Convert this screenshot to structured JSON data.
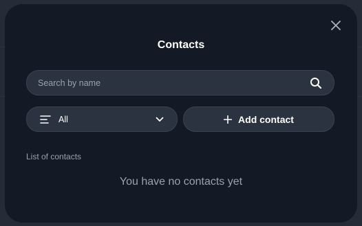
{
  "modal": {
    "title": "Contacts",
    "close_icon": "close-icon"
  },
  "search": {
    "placeholder": "Search by name",
    "value": "",
    "icon": "search-icon"
  },
  "filter": {
    "selected": "All",
    "icon": "filter-lines-icon",
    "chevron": "chevron-down-icon"
  },
  "add_contact": {
    "label": "Add contact",
    "icon": "plus-icon"
  },
  "list": {
    "heading": "List of contacts",
    "empty_message": "You have no contacts yet"
  },
  "colors": {
    "backdrop": "#262c37",
    "modal_bg": "#141a25",
    "control_bg": "#2b3340",
    "control_border": "#3a4250",
    "text_primary": "#ffffff",
    "text_muted": "#9aa1ad"
  }
}
